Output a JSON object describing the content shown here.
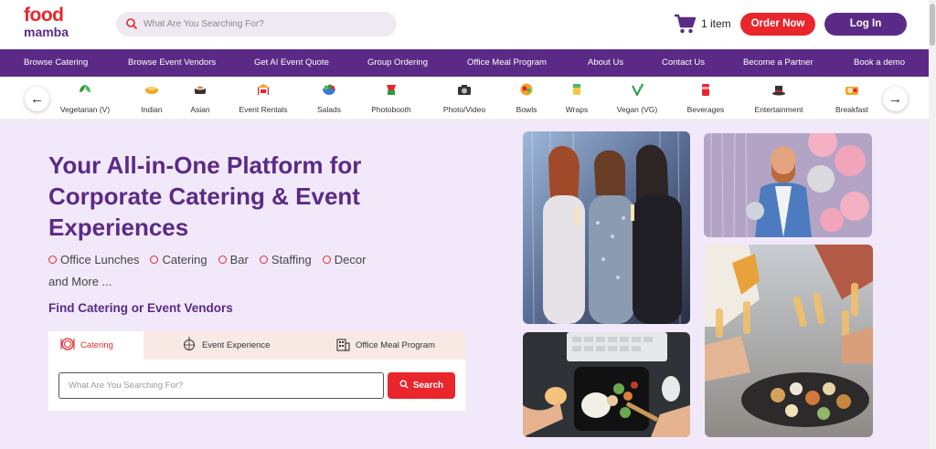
{
  "brand": {
    "line1": "food",
    "line2": "mamba"
  },
  "header": {
    "search_placeholder": "What Are You Searching For?",
    "cart_label": "1 item",
    "order_now": "Order Now",
    "login": "Log In"
  },
  "nav": {
    "items": [
      "Browse Catering",
      "Browse Event Vendors",
      "Get AI Event Quote",
      "Group Ordering",
      "Office Meal Program",
      "About Us",
      "Contact Us",
      "Become a Partner",
      "Book a demo"
    ]
  },
  "categories": {
    "prev_icon": "arrow-left-icon",
    "next_icon": "arrow-right-icon",
    "items": [
      {
        "label": "Vegetarian (V)",
        "icon": "leaves-icon"
      },
      {
        "label": "Indian",
        "icon": "samosa-icon"
      },
      {
        "label": "Asian",
        "icon": "sushi-icon"
      },
      {
        "label": "Event Rentals",
        "icon": "canopy-icon"
      },
      {
        "label": "Salads",
        "icon": "salad-bowl-icon"
      },
      {
        "label": "Photobooth",
        "icon": "photobooth-icon"
      },
      {
        "label": "Photo/Video",
        "icon": "camera-icon"
      },
      {
        "label": "Bowls",
        "icon": "bowl-icon"
      },
      {
        "label": "Wraps",
        "icon": "wrap-icon"
      },
      {
        "label": "Vegan (VG)",
        "icon": "vegan-leaf-icon"
      },
      {
        "label": "Beverages",
        "icon": "drink-can-icon"
      },
      {
        "label": "Entertainment",
        "icon": "magic-hat-icon"
      },
      {
        "label": "Breakfast",
        "icon": "breakfast-icon"
      }
    ]
  },
  "hero": {
    "headline": "Your All-in-One Platform for Corporate Catering & Event Experiences",
    "services": [
      "Office Lunches",
      "Catering",
      "Bar",
      "Staffing",
      "Decor"
    ],
    "services_more": "and More ...",
    "find_title": "Find Catering or Event Vendors",
    "tabs": [
      {
        "label": "Catering",
        "icon": "plate-icon",
        "active": true
      },
      {
        "label": "Event Experience",
        "icon": "disco-ball-icon",
        "active": false
      },
      {
        "label": "Office Meal Program",
        "icon": "office-building-icon",
        "active": false
      }
    ],
    "search_placeholder": "What Are You Searching For?",
    "search_button": "Search"
  },
  "photos": [
    {
      "name": "party-women-photo",
      "description_icon": "party-photo"
    },
    {
      "name": "man-balloons-photo",
      "description_icon": "party-photo"
    },
    {
      "name": "lunch-desk-photo",
      "description_icon": "food-photo"
    },
    {
      "name": "champagne-toast-photo",
      "description_icon": "food-photo"
    }
  ],
  "colors": {
    "brand_red": "#e8262c",
    "brand_purple": "#5b2a86",
    "hero_bg": "#f1e9fa"
  }
}
